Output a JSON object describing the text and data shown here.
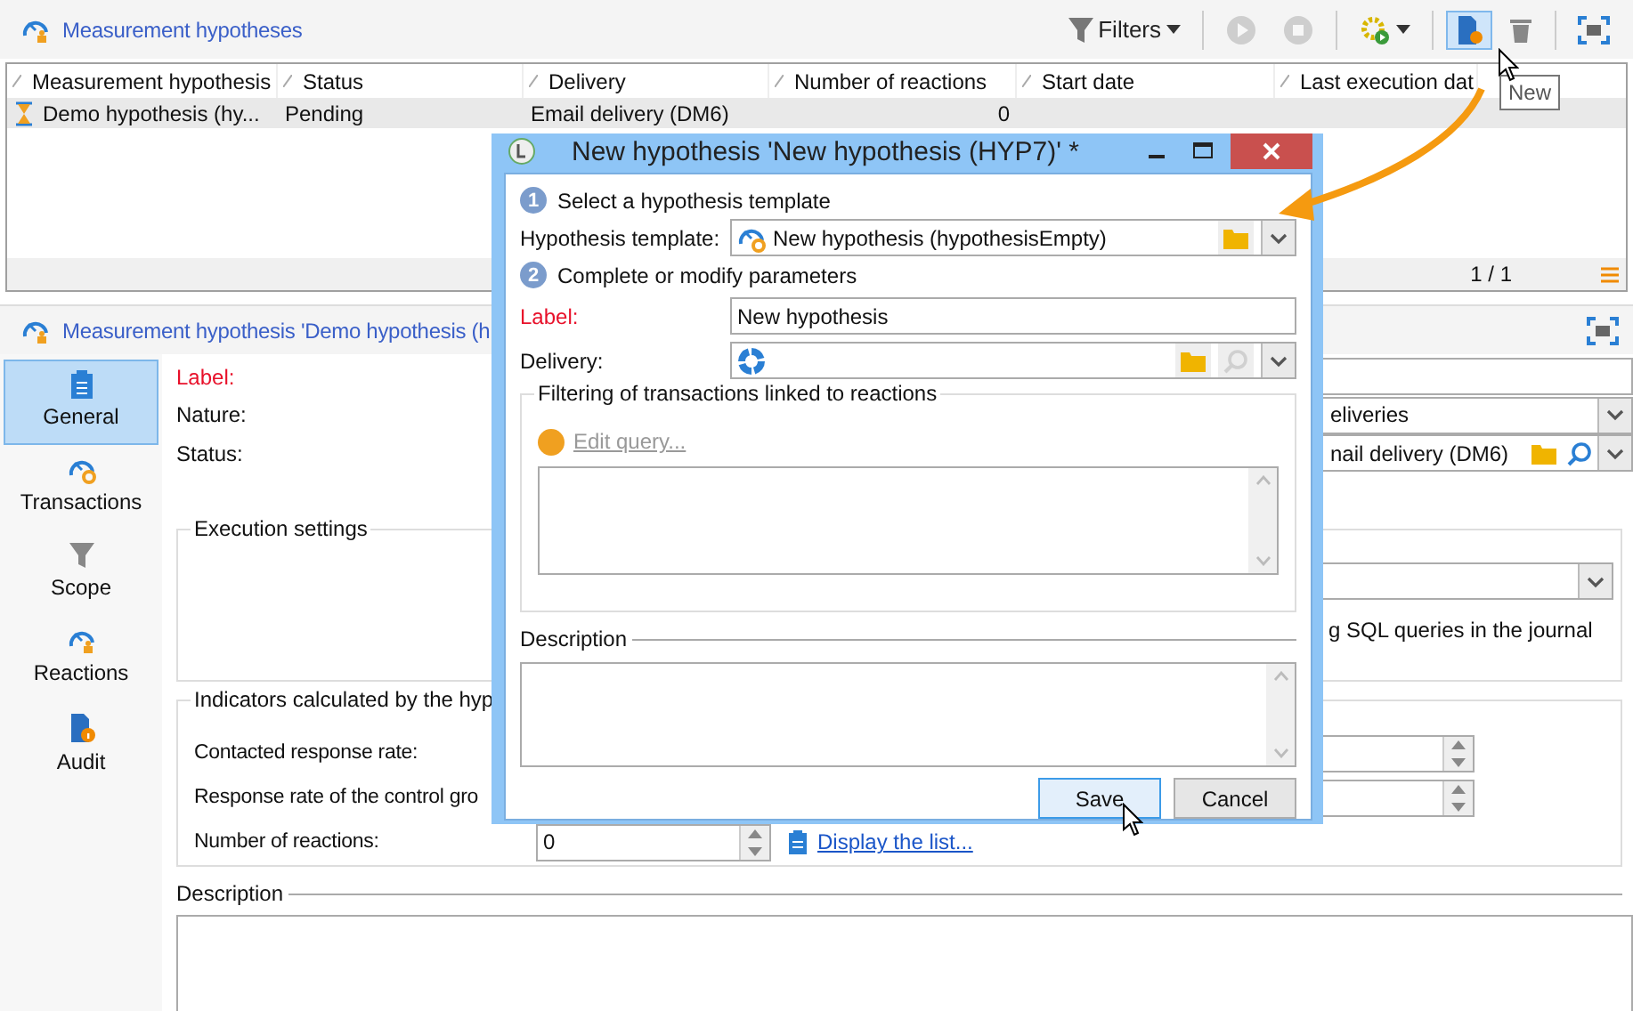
{
  "list_panel": {
    "title": "Measurement hypotheses",
    "toolbar": [
      {
        "kind": "filter",
        "label": "Filters",
        "disabled": false,
        "highlighted": false
      },
      {
        "kind": "play",
        "disabled": true,
        "highlighted": false
      },
      {
        "kind": "stop",
        "disabled": true,
        "highlighted": false
      },
      {
        "kind": "gear-run",
        "disabled": false,
        "highlighted": false
      },
      {
        "kind": "new",
        "disabled": false,
        "highlighted": true
      },
      {
        "kind": "delete",
        "disabled": false,
        "highlighted": false
      },
      {
        "kind": "fullscreen",
        "disabled": false,
        "highlighted": false
      }
    ],
    "tooltip": "New",
    "table": {
      "columns": [
        "Measurement hypothesis",
        "Status",
        "Delivery",
        "Number of reactions",
        "Start date",
        "Last execution dat"
      ],
      "rows": [
        {
          "hypothesis": "Demo hypothesis (hy...",
          "status": "Pending",
          "delivery": "Email delivery (DM6)",
          "reactions": "0",
          "selected": true
        }
      ]
    },
    "pager": "1 / 1"
  },
  "detail_panel": {
    "title": "Measurement hypothesis 'Demo hypothesis (h",
    "tabs": [
      {
        "kind": "clipboard",
        "label": "General",
        "selected": true
      },
      {
        "kind": "gauge-gear",
        "label": "Transactions",
        "selected": false
      },
      {
        "kind": "funnel",
        "label": "Scope",
        "selected": false
      },
      {
        "kind": "gauge-person",
        "label": "Reactions",
        "selected": false
      },
      {
        "kind": "document-info",
        "label": "Audit",
        "selected": false
      }
    ],
    "fields": [
      {
        "kind": "text",
        "label": "Label:",
        "required": true
      },
      {
        "kind": "dropdown",
        "label": "Nature:",
        "required": false,
        "value": "eliveries"
      },
      {
        "kind": "link",
        "label": "Status:",
        "required": false,
        "value": "nail delivery (DM6)"
      }
    ],
    "execution_settings": {
      "legend": "Execution settings",
      "note": "g SQL queries in the journal"
    },
    "indicators": {
      "legend": "Indicators calculated by the hyp",
      "rows": [
        {
          "kind": "spin",
          "label": "Contacted response rate:"
        },
        {
          "kind": "spin",
          "label": "Response rate of the control gro"
        },
        {
          "kind": "count",
          "label": "Number of reactions:",
          "value": "0",
          "link": "Display the list..."
        }
      ]
    },
    "description_legend": "Description"
  },
  "dialog": {
    "title": "New hypothesis 'New hypothesis (HYP7)' *",
    "steps": [
      {
        "number": "1",
        "text": "Select a hypothesis template"
      },
      {
        "number": "2",
        "text": "Complete or modify parameters"
      }
    ],
    "template": {
      "label": "Hypothesis template:",
      "value": "New hypothesis (hypothesisEmpty)"
    },
    "label_field": {
      "label": "Label:",
      "required": true,
      "value": "New hypothesis"
    },
    "delivery_field": {
      "label": "Delivery:",
      "required": false
    },
    "filtering": {
      "legend": "Filtering of transactions linked to reactions",
      "edit_query": "Edit query...",
      "disabled": true
    },
    "description_legend": "Description",
    "buttons": [
      {
        "label": "Save",
        "default": true
      },
      {
        "label": "Cancel",
        "default": false
      }
    ]
  }
}
